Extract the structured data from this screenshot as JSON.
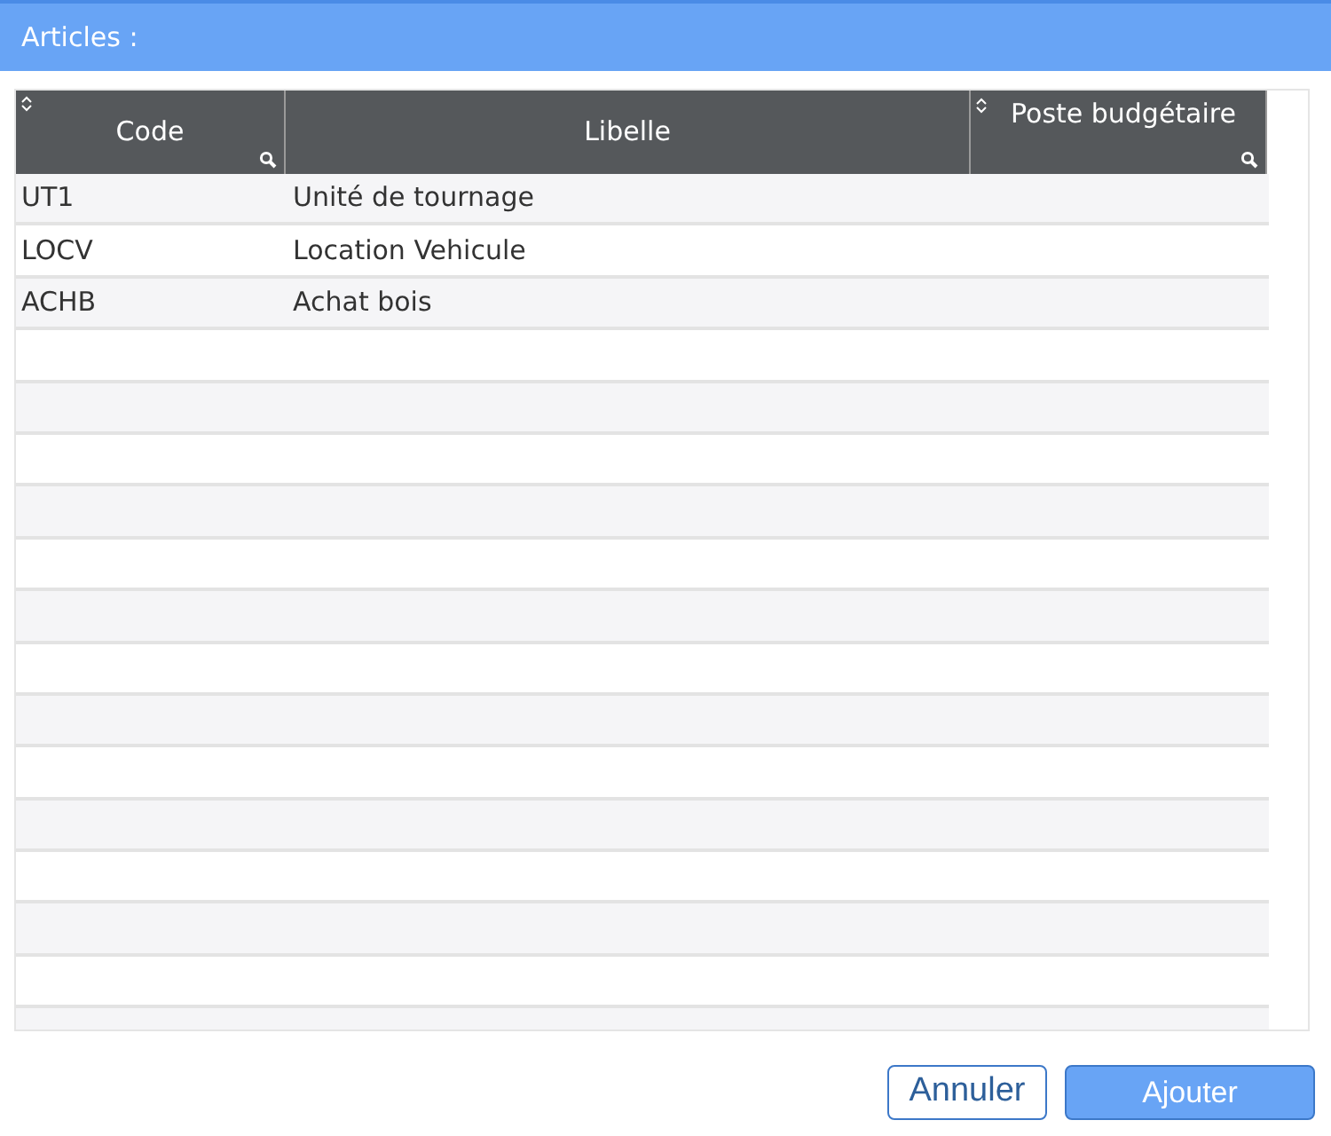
{
  "dialog": {
    "title": "Articles :"
  },
  "table": {
    "columns": [
      {
        "label": "Code",
        "sortable": true,
        "searchable": true
      },
      {
        "label": "Libelle",
        "sortable": false,
        "searchable": false
      },
      {
        "label": "Poste budgétaire",
        "sortable": true,
        "searchable": true
      }
    ],
    "rows": [
      [
        "UT1",
        "Unité de tournage",
        ""
      ],
      [
        "LOCV",
        "Location Vehicule",
        ""
      ],
      [
        "ACHB",
        "Achat bois",
        ""
      ]
    ]
  },
  "buttons": [
    {
      "label": "Annuler",
      "kind": "secondary"
    },
    {
      "label": "Ajouter",
      "kind": "primary"
    }
  ]
}
